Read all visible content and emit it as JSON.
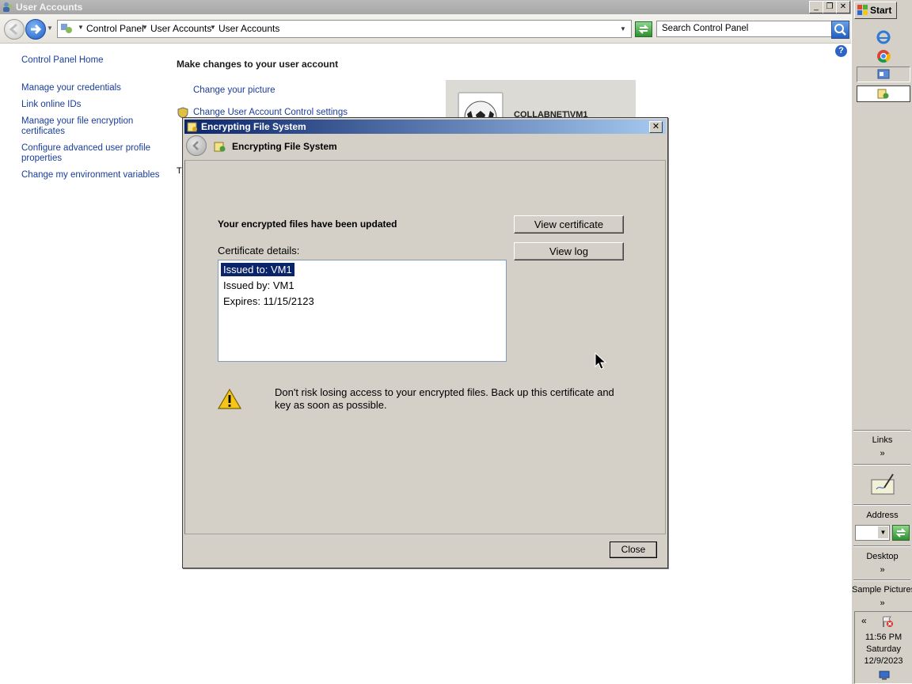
{
  "window": {
    "title": "User Accounts"
  },
  "address": {
    "crumbs": [
      "Control Panel",
      "User Accounts",
      "User Accounts"
    ],
    "search_placeholder": "Search Control Panel"
  },
  "sidebar": {
    "home": "Control Panel Home",
    "links": [
      "Manage your credentials",
      "Link online IDs",
      "Manage your file encryption certificates",
      "Configure advanced user profile properties",
      "Change my environment variables"
    ]
  },
  "main": {
    "heading": "Make changes to your user account",
    "links": [
      "Change your picture",
      "Change User Account Control settings"
    ],
    "partial_text": "T",
    "username": "COLLABNET\\VM1"
  },
  "dialog": {
    "title": "Encrypting File System",
    "header": "Encrypting File System",
    "message": "Your encrypted files have been updated",
    "cert_label": "Certificate details:",
    "cert_lines": [
      "Issued to: VM1",
      "Issued by: VM1",
      "Expires: 11/15/2123"
    ],
    "view_certificate": "View certificate",
    "view_log": "View log",
    "warning": "Don't risk losing access to your encrypted files. Back up this certificate and key as soon as possible.",
    "close": "Close"
  },
  "taskbar": {
    "start": "Start",
    "links": "Links",
    "address": "Address",
    "desktop": "Desktop",
    "sample_pictures": "Sample Pictures",
    "chevron": "»",
    "tray_chevron": "«",
    "time": "11:56 PM",
    "day": "Saturday",
    "date": "12/9/2023"
  }
}
